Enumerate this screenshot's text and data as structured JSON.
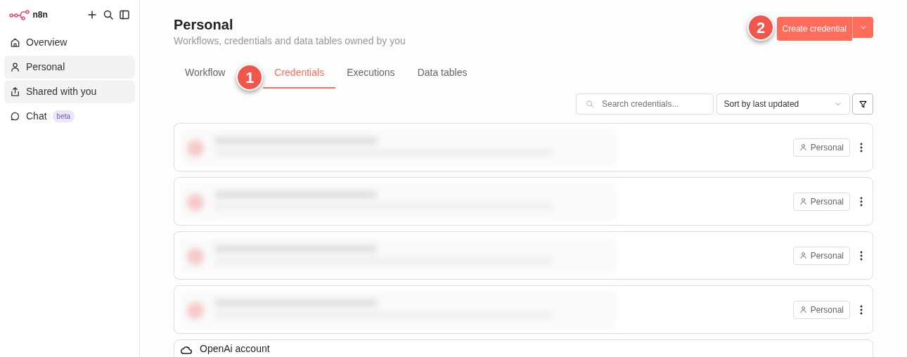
{
  "sidebar": {
    "logo": "n8n",
    "items": [
      {
        "label": "Overview",
        "selected": false
      },
      {
        "label": "Personal",
        "selected": true
      },
      {
        "label": "Shared with you",
        "selected": true
      },
      {
        "label": "Chat",
        "selected": false,
        "badge": "beta"
      }
    ]
  },
  "header": {
    "title": "Personal",
    "subtitle": "Workflows, credentials and data tables owned by you",
    "create_button": "Create credential"
  },
  "tabs": [
    {
      "label": "Workflow",
      "selected": false
    },
    {
      "label": "Credentials",
      "selected": true
    },
    {
      "label": "Executions",
      "selected": false
    },
    {
      "label": "Data tables",
      "selected": false
    }
  ],
  "toolbar": {
    "search": {
      "placeholder": "Search credentials..."
    },
    "sort": "Sort by last updated"
  },
  "credentials": [
    {
      "kind": "blurred",
      "badge": "Personal"
    },
    {
      "kind": "blurred",
      "badge": "Personal"
    },
    {
      "kind": "blurred",
      "badge": "Personal"
    },
    {
      "kind": "blurred",
      "badge": "Personal"
    },
    {
      "kind": "plain",
      "name": "OpenAi account"
    }
  ],
  "callouts": [
    {
      "number": "1"
    },
    {
      "number": "2"
    }
  ]
}
